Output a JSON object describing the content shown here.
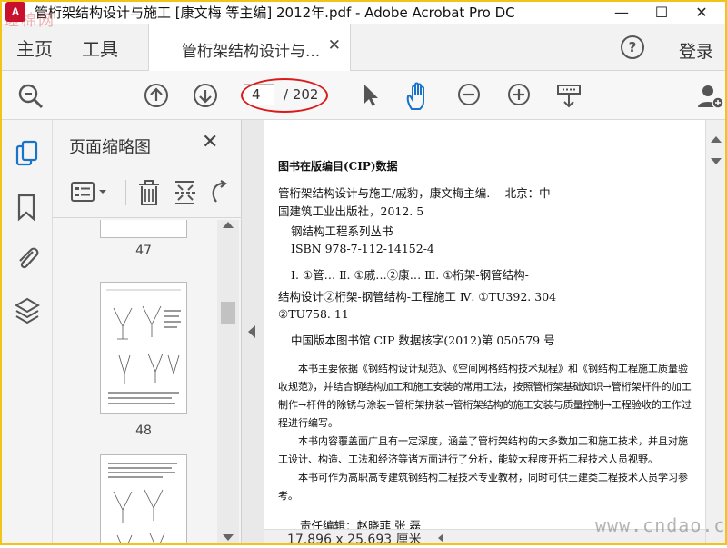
{
  "window": {
    "title": "管桁架结构设计与施工 [康文梅 等主编] 2012年.pdf - Adobe Acrobat Pro DC",
    "watermark_top": "递棉网",
    "logo_text": "A",
    "minimize": "—",
    "maximize": "☐",
    "close": "✕"
  },
  "tabs": {
    "home": "主页",
    "tools": "工具",
    "doc_tab": "管桁架结构设计与...",
    "doc_tab_close": "✕",
    "help": "?",
    "login": "登录"
  },
  "toolbar": {
    "page_current": "4",
    "page_total": "/ 202"
  },
  "panel": {
    "title": "页面缩略图",
    "close": "✕",
    "thumb_labels": [
      "47",
      "48"
    ]
  },
  "document": {
    "cip_title": "图书在版编目(CIP)数据",
    "cip_lines": [
      "管桁架结构设计与施工/戚豹，康文梅主编. —北京：中",
      "国建筑工业出版社，2012. 5",
      "钢结构工程系列丛书",
      "ISBN 978-7-112-14152-4",
      "Ⅰ. ①管…  Ⅱ. ①戚…②康…  Ⅲ. ①桁架-钢管结构-",
      "结构设计②桁架-钢管结构-工程施工   Ⅳ. ①TU392. 304",
      "②TU758. 11"
    ],
    "cip_number": "中国版本图书馆 CIP 数据核字(2012)第 050579 号",
    "paragraphs": [
      "本书主要依据《钢结构设计规范》、《空间网格结构技术规程》和《钢结构工程施工质量验收规范》，并结合钢结构加工和施工安装的常用工法，按照管桁架基础知识→管桁架杆件的加工制作→杆件的除锈与涂装→管桁架拼装→管桁架结构的施工安装与质量控制→工程验收的工作过程进行编写。",
      "本书内容覆盖面广且有一定深度，涵盖了管桁架结构的大多数加工和施工技术，并且对施工设计、构造、工法和经济等诸方面进行了分析，能较大程度开拓工程技术人员视野。",
      "本书可作为高职高专建筑钢结构工程技术专业教材，同时可供土建类工程技术人员学习参考。"
    ],
    "editor_line": "责任编辑：赵晓菲   张   磊"
  },
  "status": {
    "page_size": "17.896 x 25.693 厘米",
    "watermark_bottom": "www.cndao.com"
  },
  "colors": {
    "accent_blue": "#1a73c8",
    "annotation_red": "#d91b1b",
    "frame_yellow": "#f0c419"
  }
}
